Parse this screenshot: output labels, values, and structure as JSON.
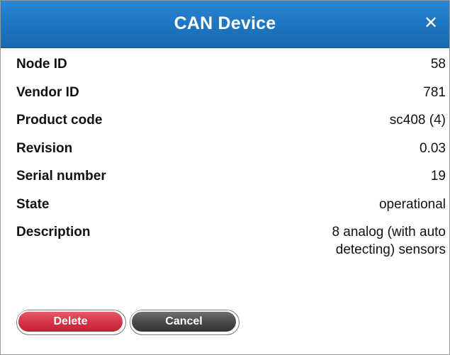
{
  "dialog": {
    "title": "CAN Device",
    "close_glyph": "✕"
  },
  "fields": [
    {
      "label": "Node ID",
      "value": "58"
    },
    {
      "label": "Vendor ID",
      "value": "781"
    },
    {
      "label": "Product code",
      "value": "sc408 (4)"
    },
    {
      "label": "Revision",
      "value": "0.03"
    },
    {
      "label": "Serial number",
      "value": "19"
    },
    {
      "label": "State",
      "value": "operational"
    },
    {
      "label": "Description",
      "value": "8 analog (with auto detecting) sensors"
    }
  ],
  "buttons": {
    "delete_label": "Delete",
    "cancel_label": "Cancel"
  },
  "colors": {
    "titlebar": "#1d74c0",
    "delete": "#d63448",
    "cancel": "#4a4a4a"
  },
  "icons": {
    "close": "close-icon"
  }
}
